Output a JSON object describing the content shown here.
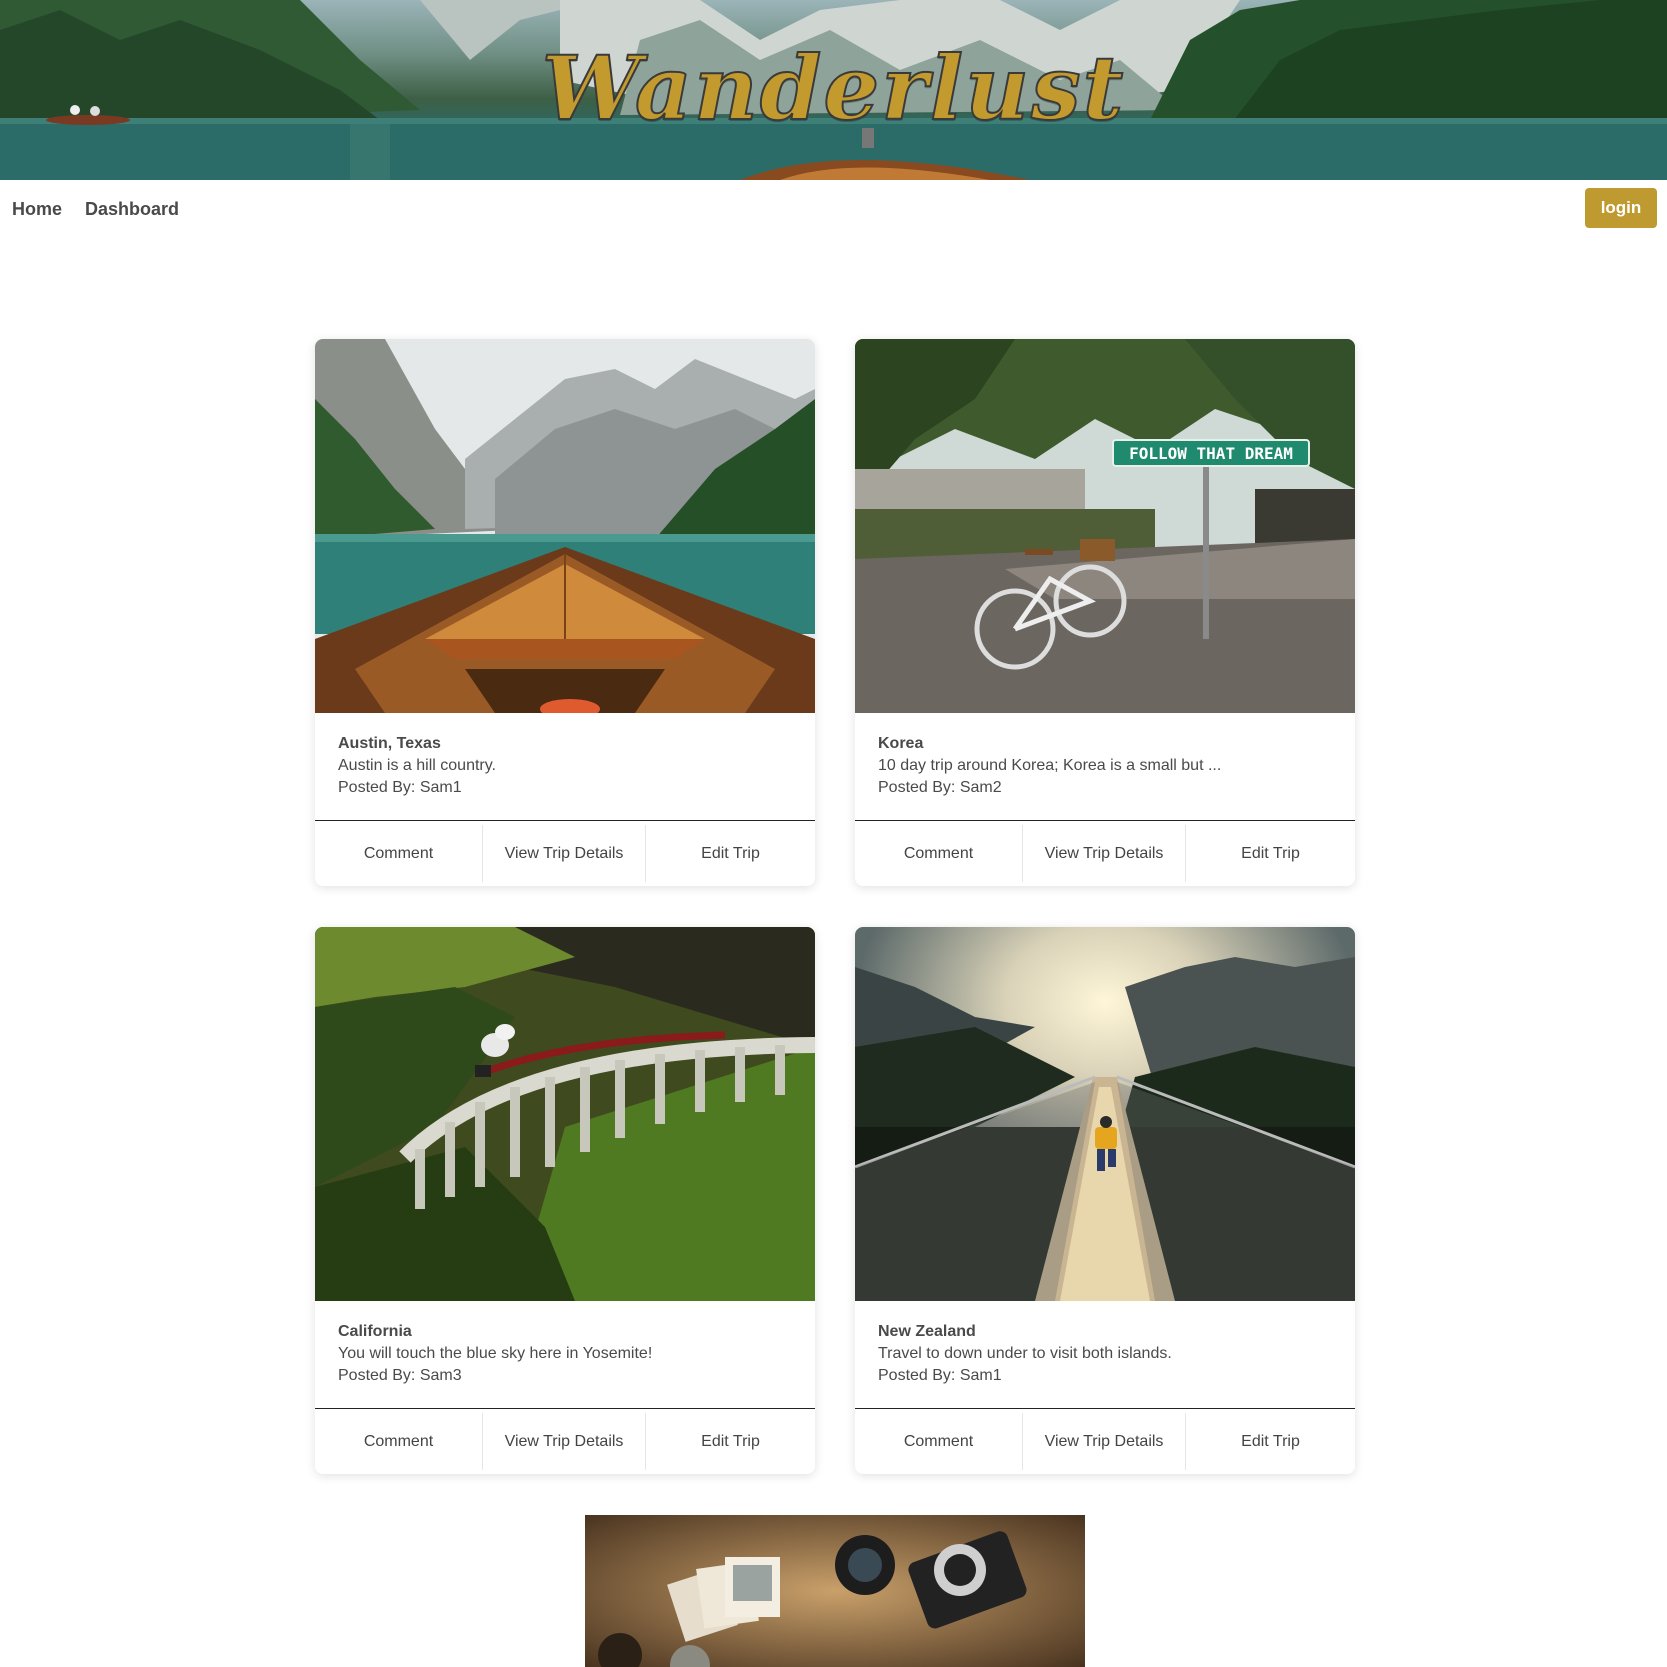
{
  "header": {
    "brand": "Wanderlust"
  },
  "nav": {
    "home": "Home",
    "dashboard": "Dashboard",
    "login": "login"
  },
  "colors": {
    "accent": "#bf9a30",
    "text": "#4a4a4a"
  },
  "trips": [
    {
      "title": "Austin, Texas",
      "description": "Austin is a hill country.",
      "posted_by": "Posted By: Sam1",
      "image": "mountain-lake-boat-photo",
      "actions": {
        "comment": "Comment",
        "view": "View Trip Details",
        "edit": "Edit Trip"
      }
    },
    {
      "title": "Korea",
      "description": "10 day trip around Korea; Korea is a small but ...",
      "posted_by": "Posted By: Sam2",
      "image": "bicycle-street-sign-photo",
      "sign_text": "FOLLOW THAT DREAM",
      "actions": {
        "comment": "Comment",
        "view": "View Trip Details",
        "edit": "Edit Trip"
      }
    },
    {
      "title": "California",
      "description": "You will touch the blue sky here in Yosemite!",
      "posted_by": "Posted By: Sam3",
      "image": "viaduct-train-photo",
      "actions": {
        "comment": "Comment",
        "view": "View Trip Details",
        "edit": "Edit Trip"
      }
    },
    {
      "title": "New Zealand",
      "description": "Travel to down under to visit both islands.",
      "posted_by": "Posted By: Sam1",
      "image": "suspension-bridge-hiker-photo",
      "actions": {
        "comment": "Comment",
        "view": "View Trip Details",
        "edit": "Edit Trip"
      }
    }
  ],
  "footer_image": "camera-map-photo"
}
